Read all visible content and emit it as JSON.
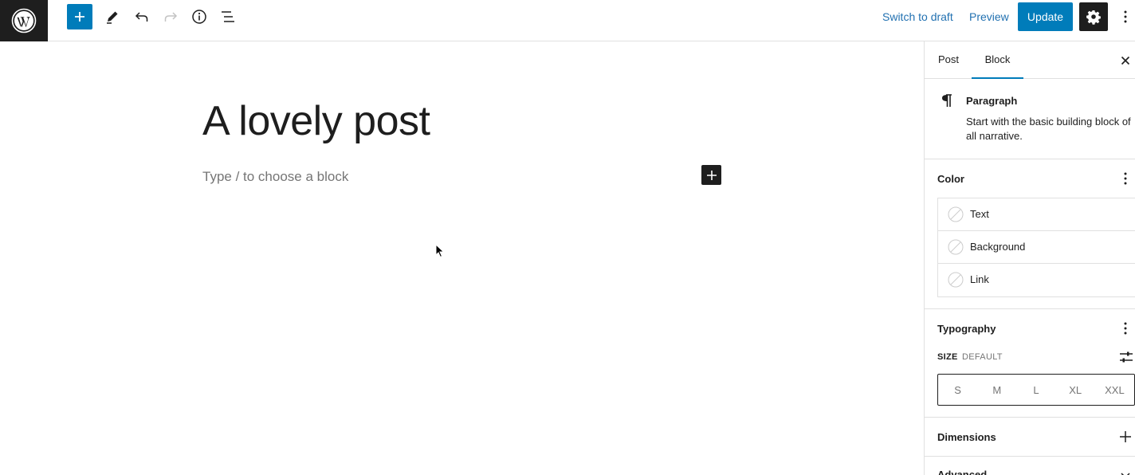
{
  "toolbar": {
    "switch_to_draft": "Switch to draft",
    "preview": "Preview",
    "update": "Update"
  },
  "editor": {
    "title": "A lovely post",
    "placeholder": "Type / to choose a block"
  },
  "sidebar": {
    "tabs": [
      {
        "label": "Post"
      },
      {
        "label": "Block"
      }
    ],
    "active_tab": "Block",
    "block": {
      "name": "Paragraph",
      "description": "Start with the basic building block of all narrative."
    },
    "color": {
      "title": "Color",
      "items": [
        {
          "label": "Text"
        },
        {
          "label": "Background"
        },
        {
          "label": "Link"
        }
      ]
    },
    "typography": {
      "title": "Typography",
      "size_label": "Size",
      "size_value": "Default",
      "sizes": [
        "S",
        "M",
        "L",
        "XL",
        "XXL"
      ]
    },
    "dimensions": {
      "title": "Dimensions"
    },
    "advanced": {
      "title": "Advanced"
    }
  },
  "colors": {
    "accent": "#007cba",
    "dark": "#1e1e1e"
  },
  "icons": [
    "wordpress-icon",
    "plus-icon",
    "pencil-icon",
    "undo-icon",
    "redo-icon",
    "info-icon",
    "list-view-icon",
    "gear-icon",
    "kebab-icon",
    "close-icon",
    "pilcrow-icon",
    "sliders-icon",
    "chevron-down-icon"
  ]
}
